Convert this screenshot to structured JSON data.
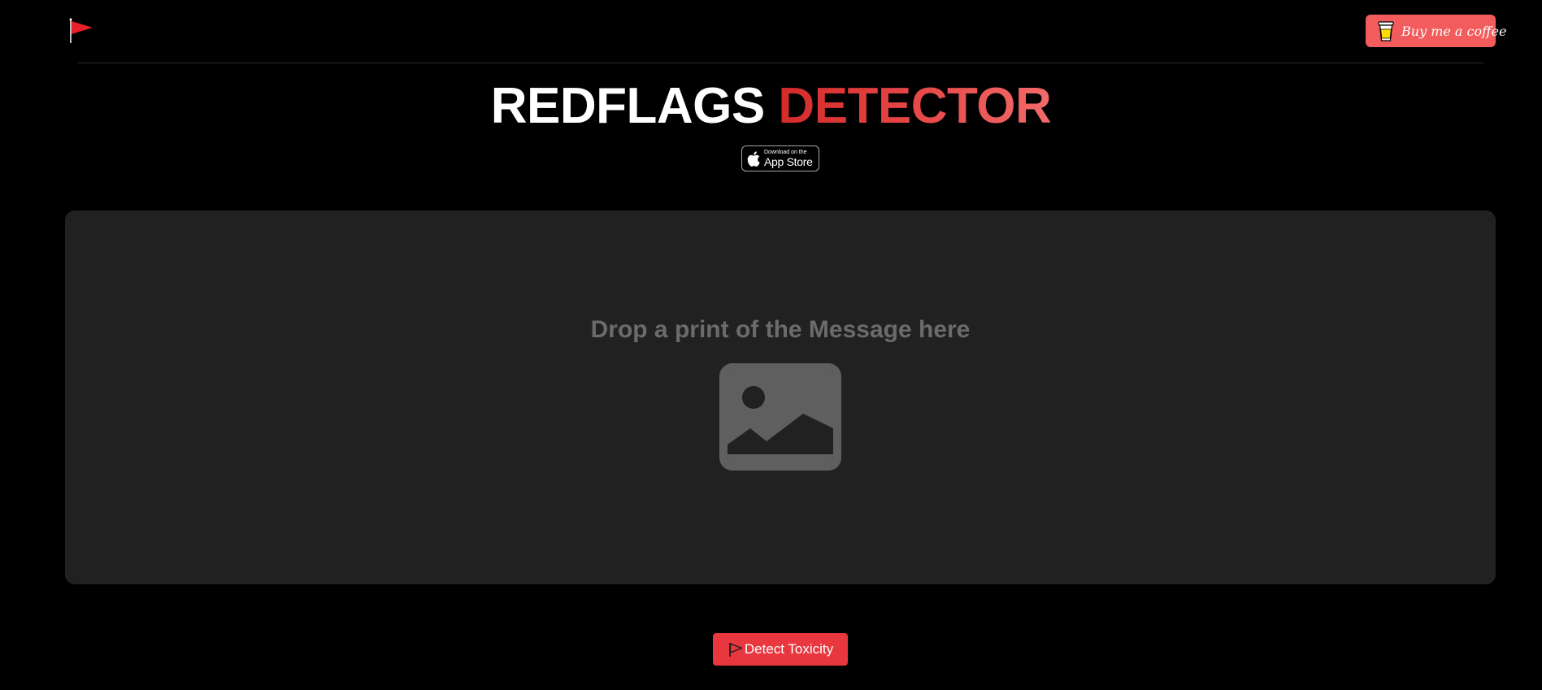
{
  "header": {
    "logo_icon": "red-flag-icon",
    "coffee_button": {
      "label": "Buy me a coffee",
      "icon": "coffee-cup-icon",
      "color": "#f25c5c"
    }
  },
  "title": {
    "part1": "REDFLAGS",
    "part2": "DETECTOR"
  },
  "app_store_badge": {
    "small_text": "Download on the",
    "big_text": "App Store",
    "icon": "apple-icon"
  },
  "dropzone": {
    "prompt": "Drop a print of the Message here",
    "icon": "image-placeholder-icon",
    "background": "#212121"
  },
  "detect_button": {
    "label": "Detect Toxicity",
    "icon": "flag-outline-icon",
    "color": "#e8373f"
  }
}
